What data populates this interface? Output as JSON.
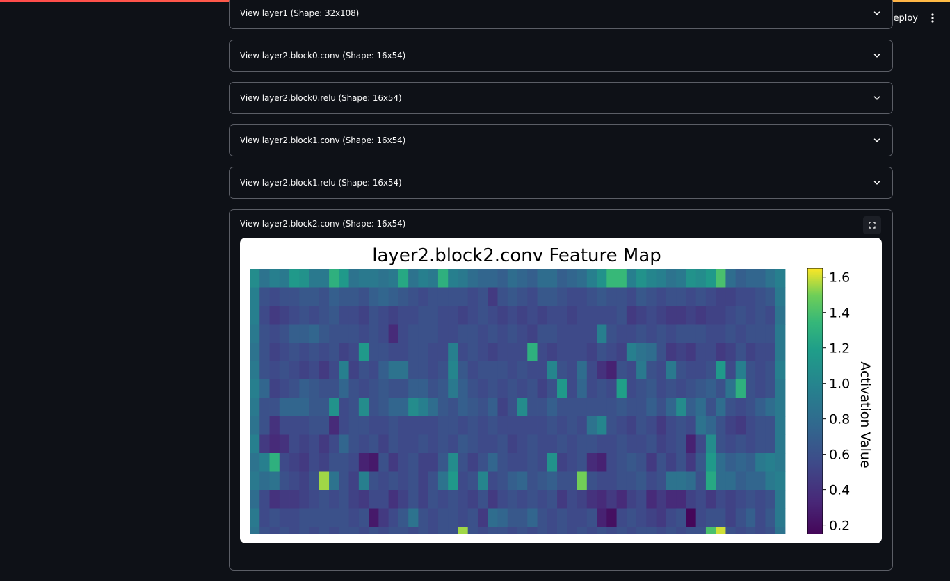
{
  "header": {
    "deploy_label": "Deploy",
    "menu_icon": "more-vertical-icon"
  },
  "expanders": [
    {
      "label": "View layer1 (Shape: 32x108)"
    },
    {
      "label": "View layer2.block0.conv (Shape: 16x54)"
    },
    {
      "label": "View layer2.block0.relu (Shape: 16x54)"
    },
    {
      "label": "View layer2.block1.conv (Shape: 16x54)"
    },
    {
      "label": "View layer2.block1.relu (Shape: 16x54)"
    },
    {
      "label": "View layer2.block2.conv (Shape: 16x54)"
    }
  ],
  "colors": {
    "accent_gradient_start": "#ff4b4b",
    "accent_gradient_end": "#ffbd45",
    "background": "#0e1117",
    "border": "#5b5e66"
  },
  "chart_data": {
    "type": "heatmap",
    "title": "layer2.block2.conv Feature Map",
    "colorbar_label": "Activation Value",
    "colormap": "viridis",
    "colorbar_range": [
      0.12,
      1.65
    ],
    "colorbar_ticks": [
      "1.6",
      "1.4",
      "1.2",
      "1.0",
      "0.8",
      "0.6",
      "0.4",
      "0.2"
    ],
    "colorbar_tick_values": [
      1.6,
      1.4,
      1.2,
      1.0,
      0.8,
      0.6,
      0.4,
      0.2
    ],
    "rows": 16,
    "cols": 54,
    "visible_rows": 15,
    "values": [
      [
        1.05,
        0.85,
        0.95,
        0.9,
        1.15,
        1.1,
        0.9,
        0.9,
        1.3,
        1.15,
        0.85,
        0.9,
        0.9,
        0.85,
        0.9,
        1.25,
        0.85,
        0.95,
        0.9,
        1.3,
        0.95,
        0.9,
        0.8,
        0.75,
        0.75,
        0.7,
        0.8,
        0.75,
        0.7,
        0.8,
        0.8,
        0.7,
        0.75,
        0.8,
        0.95,
        1.1,
        1.35,
        1.35,
        0.95,
        1.1,
        1.0,
        0.95,
        0.85,
        0.9,
        1.1,
        1.05,
        1.15,
        1.4,
        0.8,
        0.7,
        0.75,
        0.75,
        0.85,
        0.95
      ],
      [
        0.95,
        0.6,
        0.55,
        0.6,
        0.6,
        0.65,
        0.65,
        0.6,
        0.7,
        0.65,
        0.65,
        0.6,
        0.7,
        0.75,
        0.7,
        0.65,
        0.6,
        0.55,
        0.6,
        0.6,
        0.6,
        0.6,
        0.55,
        0.6,
        0.45,
        0.6,
        0.65,
        0.6,
        0.55,
        0.65,
        0.65,
        0.6,
        0.55,
        0.55,
        0.6,
        0.65,
        0.6,
        0.6,
        0.55,
        0.65,
        0.6,
        0.55,
        0.6,
        0.6,
        0.55,
        0.6,
        0.55,
        0.5,
        0.5,
        0.55,
        0.55,
        0.6,
        0.65,
        0.9
      ],
      [
        0.95,
        0.55,
        0.45,
        0.5,
        0.55,
        0.6,
        0.55,
        0.6,
        0.65,
        0.55,
        0.55,
        0.5,
        0.6,
        0.55,
        0.5,
        0.55,
        0.55,
        0.6,
        0.6,
        0.55,
        0.55,
        0.5,
        0.55,
        0.6,
        0.55,
        0.5,
        0.55,
        0.5,
        0.55,
        0.5,
        0.55,
        0.55,
        0.5,
        0.55,
        0.55,
        0.55,
        0.55,
        0.6,
        0.45,
        0.5,
        0.55,
        0.5,
        0.45,
        0.45,
        0.5,
        0.45,
        0.5,
        0.5,
        0.55,
        0.6,
        0.55,
        0.6,
        0.55,
        0.85
      ],
      [
        0.9,
        0.6,
        0.55,
        0.6,
        0.7,
        0.7,
        0.75,
        0.65,
        0.6,
        0.6,
        0.6,
        0.55,
        0.6,
        0.55,
        0.35,
        0.55,
        0.6,
        0.6,
        0.6,
        0.55,
        0.55,
        0.6,
        0.6,
        0.55,
        0.6,
        0.55,
        0.6,
        0.55,
        0.5,
        0.6,
        0.6,
        0.55,
        0.55,
        0.55,
        0.55,
        0.95,
        0.6,
        0.55,
        0.55,
        0.6,
        0.55,
        0.6,
        0.55,
        0.6,
        0.6,
        0.6,
        0.55,
        0.55,
        0.6,
        0.55,
        0.6,
        0.6,
        0.6,
        0.9
      ],
      [
        0.85,
        0.6,
        0.5,
        0.55,
        0.6,
        0.55,
        0.6,
        0.55,
        0.6,
        0.5,
        0.55,
        1.15,
        0.6,
        0.6,
        0.55,
        0.55,
        0.6,
        0.6,
        0.55,
        0.55,
        0.95,
        0.55,
        0.6,
        0.55,
        0.5,
        0.55,
        0.55,
        0.55,
        1.3,
        0.55,
        0.5,
        0.55,
        0.55,
        0.55,
        0.5,
        0.6,
        0.55,
        0.5,
        0.95,
        0.85,
        0.8,
        0.6,
        0.45,
        0.5,
        0.45,
        0.55,
        0.55,
        0.45,
        0.5,
        0.6,
        0.5,
        0.55,
        0.55,
        0.9
      ],
      [
        0.9,
        0.6,
        0.55,
        0.6,
        0.55,
        0.5,
        0.55,
        0.45,
        0.55,
        0.95,
        0.5,
        0.6,
        0.55,
        0.7,
        0.85,
        0.85,
        0.6,
        0.6,
        0.55,
        0.6,
        1.0,
        0.65,
        0.55,
        0.6,
        0.6,
        0.6,
        0.55,
        0.6,
        0.55,
        0.55,
        1.0,
        0.6,
        0.55,
        0.8,
        0.55,
        0.4,
        0.3,
        0.6,
        0.55,
        0.9,
        0.6,
        0.55,
        0.9,
        0.6,
        0.55,
        0.55,
        0.6,
        1.15,
        0.55,
        0.95,
        0.6,
        0.55,
        0.6,
        0.95
      ],
      [
        0.95,
        0.75,
        0.5,
        0.55,
        0.6,
        0.7,
        0.65,
        0.6,
        0.6,
        0.75,
        0.6,
        0.55,
        0.6,
        0.65,
        0.6,
        0.6,
        0.7,
        0.7,
        0.6,
        0.65,
        0.9,
        0.7,
        0.6,
        0.55,
        0.6,
        0.55,
        0.6,
        0.55,
        0.6,
        0.5,
        0.6,
        1.15,
        0.55,
        0.75,
        0.55,
        0.6,
        0.55,
        1.2,
        0.55,
        0.6,
        0.65,
        0.55,
        0.6,
        0.55,
        0.6,
        0.65,
        0.7,
        0.6,
        0.85,
        1.3,
        0.6,
        0.55,
        0.6,
        0.9
      ],
      [
        0.9,
        0.6,
        0.6,
        0.75,
        0.75,
        0.75,
        0.65,
        0.65,
        1.1,
        0.55,
        0.6,
        1.05,
        0.6,
        0.65,
        0.75,
        0.75,
        1.05,
        0.95,
        0.8,
        0.65,
        0.6,
        0.7,
        0.65,
        0.6,
        0.7,
        0.5,
        0.6,
        1.05,
        0.6,
        0.6,
        0.7,
        0.6,
        0.6,
        0.6,
        0.6,
        0.6,
        0.6,
        0.65,
        0.6,
        0.6,
        0.7,
        0.6,
        0.75,
        1.05,
        0.7,
        0.8,
        0.6,
        0.8,
        0.6,
        0.55,
        0.6,
        0.7,
        0.8,
        0.9
      ],
      [
        0.85,
        0.6,
        0.4,
        0.55,
        0.55,
        0.55,
        0.6,
        0.6,
        0.35,
        0.55,
        0.6,
        0.6,
        0.55,
        0.55,
        0.6,
        0.55,
        0.55,
        0.55,
        0.55,
        0.6,
        0.6,
        0.55,
        0.6,
        0.55,
        0.6,
        0.55,
        0.55,
        0.55,
        0.55,
        0.55,
        0.6,
        0.55,
        0.6,
        0.55,
        0.85,
        1.0,
        0.6,
        0.55,
        0.5,
        0.6,
        0.55,
        0.45,
        0.55,
        0.6,
        0.55,
        0.85,
        0.75,
        0.6,
        0.5,
        0.45,
        0.55,
        0.6,
        0.6,
        0.9
      ],
      [
        0.95,
        0.45,
        0.35,
        0.4,
        0.55,
        0.5,
        0.55,
        0.45,
        0.55,
        0.75,
        0.6,
        0.55,
        0.6,
        0.5,
        0.6,
        0.55,
        0.55,
        0.6,
        0.55,
        0.6,
        0.55,
        0.65,
        0.6,
        0.55,
        0.55,
        0.6,
        0.5,
        0.55,
        0.6,
        0.55,
        0.55,
        0.6,
        0.55,
        0.6,
        0.6,
        0.55,
        0.55,
        0.6,
        0.55,
        0.55,
        0.6,
        0.5,
        0.55,
        0.6,
        0.3,
        0.55,
        1.05,
        0.6,
        0.55,
        0.6,
        0.55,
        0.6,
        0.6,
        0.9
      ],
      [
        0.85,
        0.95,
        1.3,
        0.55,
        0.5,
        0.45,
        0.55,
        0.5,
        0.6,
        0.6,
        0.55,
        0.3,
        0.25,
        0.6,
        0.45,
        0.55,
        0.6,
        0.5,
        0.5,
        0.65,
        1.05,
        0.6,
        0.5,
        0.6,
        0.75,
        0.6,
        0.55,
        0.55,
        0.6,
        0.55,
        1.1,
        0.5,
        0.55,
        0.6,
        0.35,
        0.3,
        0.55,
        0.6,
        0.65,
        0.6,
        0.45,
        0.6,
        0.5,
        0.6,
        0.45,
        0.65,
        1.15,
        0.8,
        0.7,
        0.75,
        0.7,
        0.9,
        0.95,
        0.9
      ],
      [
        0.9,
        0.8,
        0.85,
        0.6,
        0.55,
        0.5,
        0.6,
        1.55,
        0.85,
        0.6,
        0.5,
        0.95,
        0.6,
        0.55,
        0.6,
        0.55,
        0.6,
        0.5,
        0.6,
        0.85,
        1.15,
        0.55,
        0.6,
        1.0,
        0.55,
        0.6,
        0.7,
        0.75,
        0.6,
        0.65,
        0.7,
        0.6,
        0.6,
        1.5,
        0.6,
        0.55,
        0.55,
        0.6,
        0.6,
        0.65,
        0.55,
        0.6,
        0.85,
        0.85,
        0.8,
        0.6,
        1.25,
        0.8,
        0.8,
        0.7,
        0.75,
        0.75,
        0.9,
        0.95
      ],
      [
        0.8,
        0.55,
        0.4,
        0.45,
        0.45,
        0.5,
        0.55,
        0.6,
        0.55,
        0.6,
        0.5,
        0.45,
        0.55,
        0.55,
        0.4,
        0.5,
        0.6,
        0.5,
        0.6,
        0.55,
        0.6,
        0.55,
        0.5,
        0.6,
        0.45,
        0.55,
        0.6,
        0.55,
        0.6,
        0.55,
        0.6,
        0.45,
        0.55,
        0.5,
        0.4,
        0.35,
        0.45,
        0.35,
        0.5,
        0.55,
        0.35,
        0.45,
        0.35,
        0.35,
        0.5,
        0.55,
        0.45,
        0.55,
        0.5,
        0.55,
        0.6,
        0.55,
        0.6,
        0.9
      ],
      [
        0.9,
        0.55,
        0.6,
        0.55,
        0.55,
        0.6,
        0.6,
        0.6,
        0.6,
        0.6,
        0.55,
        0.6,
        0.25,
        0.45,
        0.55,
        0.65,
        0.85,
        0.6,
        0.55,
        0.6,
        0.6,
        0.55,
        0.6,
        0.45,
        0.8,
        0.75,
        0.65,
        0.65,
        0.75,
        0.6,
        0.55,
        0.6,
        0.55,
        0.55,
        0.6,
        0.3,
        0.2,
        0.55,
        0.6,
        0.55,
        0.5,
        0.45,
        0.55,
        0.6,
        0.15,
        0.55,
        0.6,
        0.6,
        0.5,
        0.6,
        0.7,
        0.55,
        0.65,
        0.9
      ],
      [
        0.85,
        0.6,
        0.55,
        0.6,
        0.55,
        0.6,
        0.55,
        0.6,
        0.55,
        0.6,
        0.6,
        0.55,
        0.6,
        0.55,
        0.6,
        0.6,
        0.55,
        0.6,
        0.55,
        0.6,
        0.6,
        1.55,
        0.6,
        0.55,
        0.6,
        0.6,
        0.55,
        0.6,
        0.55,
        0.6,
        0.55,
        0.6,
        0.55,
        0.6,
        0.55,
        0.6,
        0.55,
        0.6,
        0.55,
        0.6,
        0.6,
        0.55,
        0.6,
        0.55,
        0.6,
        0.6,
        1.4,
        1.6,
        0.6,
        0.55,
        0.6,
        0.55,
        0.6,
        0.85
      ]
    ]
  }
}
